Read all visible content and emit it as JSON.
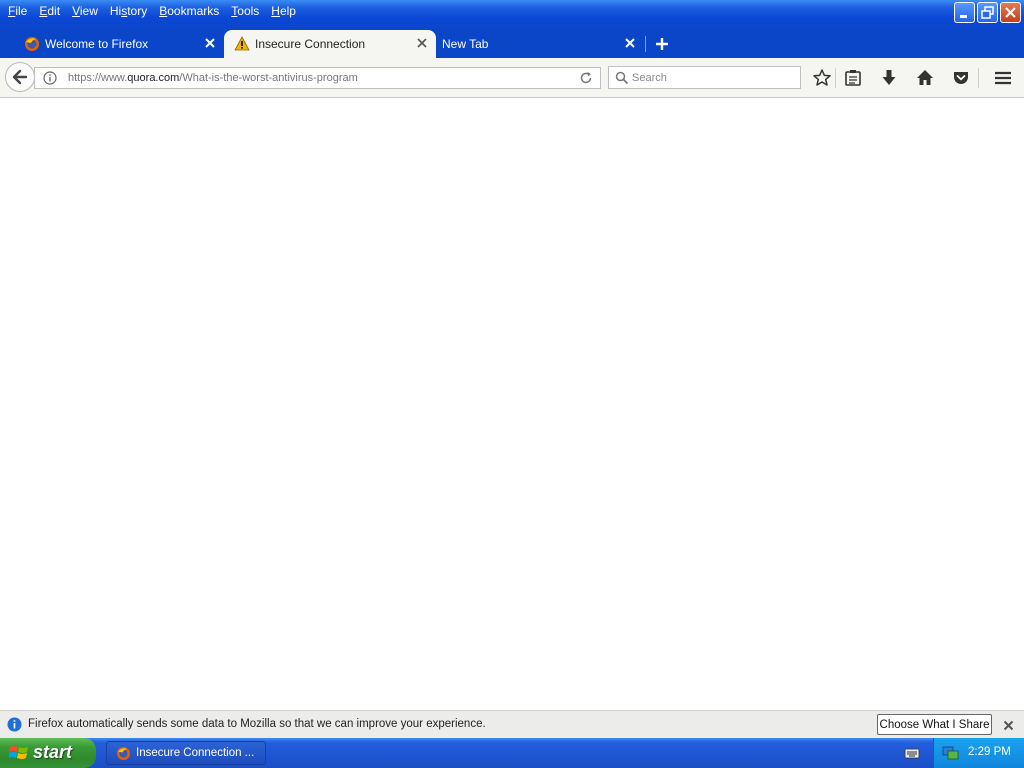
{
  "menu": {
    "file": {
      "acc": "F",
      "rest": "ile"
    },
    "edit": {
      "acc": "E",
      "rest": "dit"
    },
    "view": {
      "acc": "V",
      "rest": "iew"
    },
    "history": {
      "pre": "Hi",
      "acc": "s",
      "rest": "tory"
    },
    "bookmarks": {
      "acc": "B",
      "rest": "ookmarks"
    },
    "tools": {
      "acc": "T",
      "rest": "ools"
    },
    "help": {
      "acc": "H",
      "rest": "elp"
    }
  },
  "tabs": [
    {
      "title": "Welcome to Firefox",
      "icon": "firefox-icon",
      "selected": false
    },
    {
      "title": "Insecure Connection",
      "icon": "warning-icon",
      "selected": true
    },
    {
      "title": "New Tab",
      "icon": "",
      "selected": false
    }
  ],
  "urlbar": {
    "scheme": "https://www.",
    "host": "quora.com",
    "path": "/What-is-the-worst-antivirus-program"
  },
  "search": {
    "placeholder": "Search"
  },
  "notification": {
    "text": "Firefox automatically sends some data to Mozilla so that we can improve your experience.",
    "button": "Choose What I Share"
  },
  "taskbar": {
    "start_label": "start",
    "task_label": "Insecure Connection ...",
    "clock": "2:29 PM"
  },
  "colors": {
    "titlebar": "#0b46c8",
    "selected_tab": "#f5f5f2",
    "start_green": "#3a9a36"
  }
}
